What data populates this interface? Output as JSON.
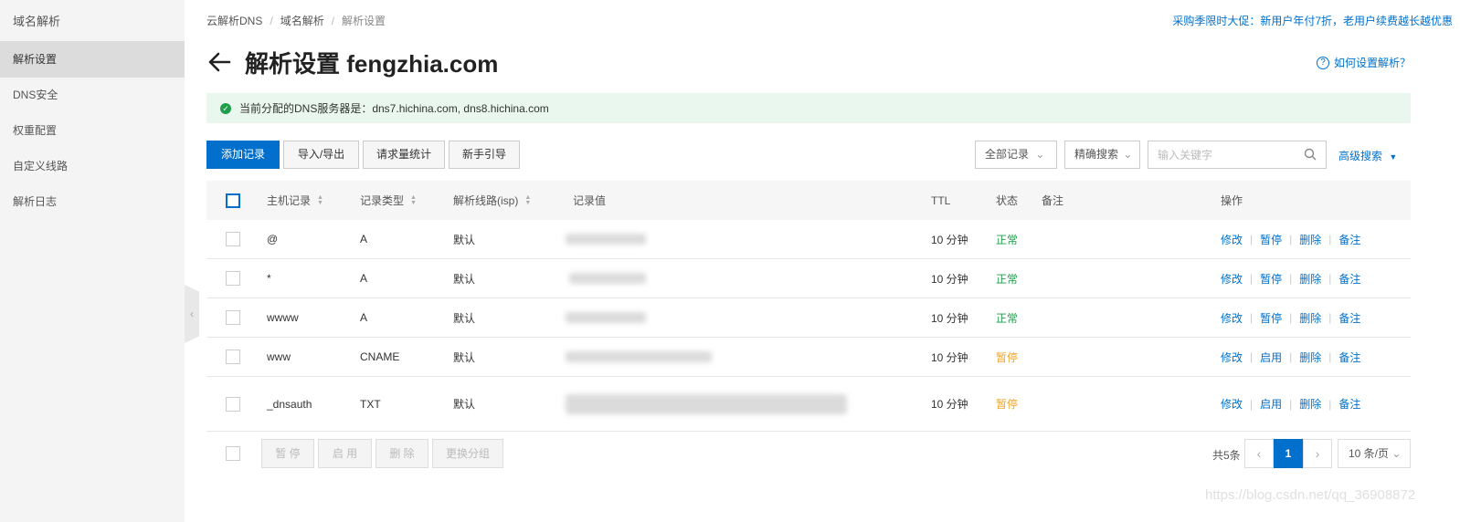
{
  "sidebar": {
    "title": "域名解析",
    "items": [
      {
        "label": "解析设置",
        "active": true
      },
      {
        "label": "DNS安全"
      },
      {
        "label": "权重配置"
      },
      {
        "label": "自定义线路"
      },
      {
        "label": "解析日志"
      }
    ]
  },
  "breadcrumb": [
    "云解析DNS",
    "域名解析",
    "解析设置"
  ],
  "promo": "采购季限时大促：新用户年付7折，老用户续费越长越优惠",
  "page_title": "解析设置 fengzhia.com",
  "help_link": "如何设置解析？",
  "dns_notice": "当前分配的DNS服务器是：dns7.hichina.com, dns8.hichina.com",
  "toolbar": {
    "add": "添加记录",
    "import_export": "导入/导出",
    "stats": "请求量统计",
    "guide": "新手引导",
    "filter_all": "全部记录",
    "precise": "精确搜索",
    "search_placeholder": "输入关键字",
    "advanced": "高级搜索"
  },
  "table": {
    "headers": {
      "host": "主机记录",
      "type": "记录类型",
      "line": "解析线路(isp)",
      "value": "记录值",
      "ttl": "TTL",
      "status": "状态",
      "remark": "备注",
      "ops": "操作"
    },
    "rows": [
      {
        "host": "@",
        "type": "A",
        "line": "默认",
        "ttl": "10 分钟",
        "status": "正常",
        "status_kind": "ok",
        "toggle": "暂停"
      },
      {
        "host": "*",
        "type": "A",
        "line": "默认",
        "ttl": "10 分钟",
        "status": "正常",
        "status_kind": "ok",
        "toggle": "暂停"
      },
      {
        "host": "wwww",
        "type": "A",
        "line": "默认",
        "ttl": "10 分钟",
        "status": "正常",
        "status_kind": "ok",
        "toggle": "暂停"
      },
      {
        "host": "www",
        "type": "CNAME",
        "line": "默认",
        "ttl": "10 分钟",
        "status": "暂停",
        "status_kind": "paused",
        "toggle": "启用"
      },
      {
        "host": "_dnsauth",
        "type": "TXT",
        "line": "默认",
        "ttl": "10 分钟",
        "status": "暂停",
        "status_kind": "paused",
        "toggle": "启用"
      }
    ],
    "op_edit": "修改",
    "op_delete": "删除",
    "op_remark": "备注"
  },
  "bulk": {
    "pause": "暂 停",
    "enable": "启 用",
    "delete": "删 除",
    "group": "更换分组"
  },
  "pagination": {
    "total": "共5条",
    "current": "1",
    "page_size": "10 条/页"
  },
  "watermark": "https://blog.csdn.net/qq_36908872",
  "colors": {
    "accent": "#0070cc",
    "ok": "#1e9e4a",
    "paused": "#f5a623",
    "notice_bg": "#e9f7ee"
  }
}
